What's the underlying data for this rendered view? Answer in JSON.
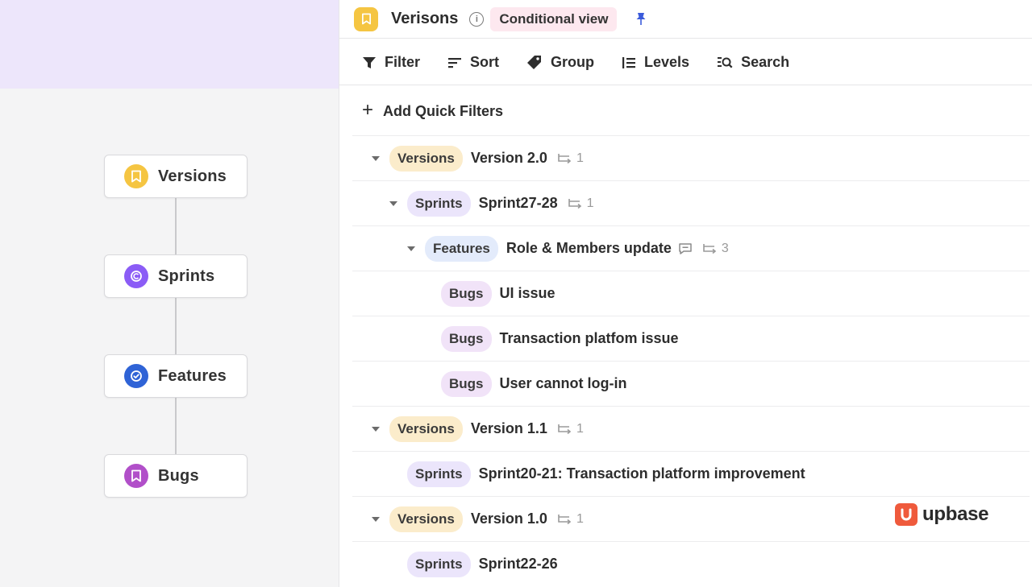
{
  "levels": [
    {
      "label": "Versions",
      "icon": "bookmark-icon",
      "color": "#f5c542"
    },
    {
      "label": "Sprints",
      "icon": "sprint-cycle-icon",
      "color": "#8b5cf6"
    },
    {
      "label": "Features",
      "icon": "check-circle-icon",
      "color": "#2f63d6"
    },
    {
      "label": "Bugs",
      "icon": "bookmark-icon",
      "color": "#b14fc9"
    }
  ],
  "header": {
    "title": "Verisons",
    "icon": "bookmark-icon",
    "view_badge": "Conditional view"
  },
  "toolbar": {
    "filter": "Filter",
    "sort": "Sort",
    "group": "Group",
    "levels": "Levels",
    "search": "Search"
  },
  "quick_filters": {
    "label": "Add Quick Filters"
  },
  "rows": [
    {
      "type": "Versions",
      "name": "Version 2.0",
      "sub_count": "1"
    },
    {
      "type": "Sprints",
      "name": "Sprint27-28",
      "sub_count": "1"
    },
    {
      "type": "Features",
      "name": "Role & Members update",
      "sub_count": "3"
    },
    {
      "type": "Bugs",
      "name": "UI issue"
    },
    {
      "type": "Bugs",
      "name": "Transaction platfom issue"
    },
    {
      "type": "Bugs",
      "name": "User cannot log-in"
    },
    {
      "type": "Versions",
      "name": "Version 1.1",
      "sub_count": "1"
    },
    {
      "type": "Sprints",
      "name": "Sprint20-21: Transaction platform improvement"
    },
    {
      "type": "Versions",
      "name": "Version 1.0",
      "sub_count": "1"
    },
    {
      "type": "Sprints",
      "name": "Sprint22-26"
    }
  ],
  "brand": {
    "name": "upbase",
    "color": "#ef5a3c"
  }
}
